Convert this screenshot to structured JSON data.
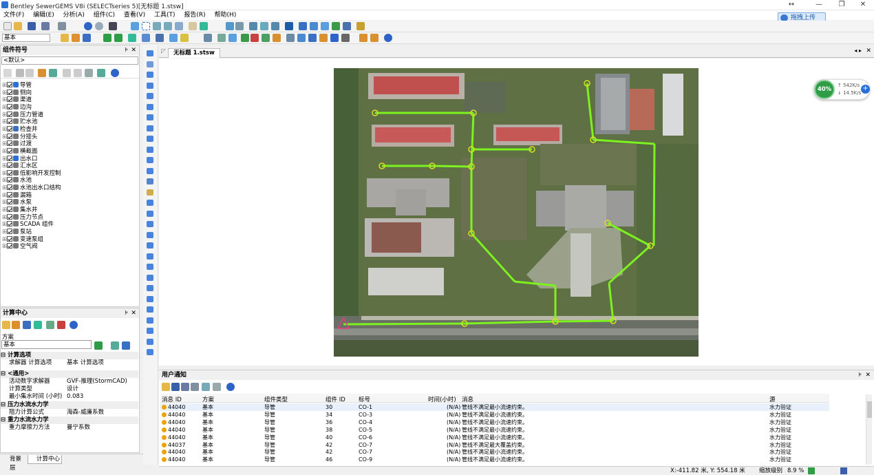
{
  "window": {
    "title": "Bentley SewerGEMS V8i (SELECTseries 5)[无标题 1.stsw]",
    "controls": [
      "↔",
      "—",
      "❐",
      "✕"
    ]
  },
  "cloud_button": "拖拽上传",
  "menu": [
    "文件(F)",
    "编辑(E)",
    "分析(A)",
    "组件(C)",
    "查看(V)",
    "工具(T)",
    "报告(R)",
    "帮助(H)"
  ],
  "toolbar": {
    "scenario_select": "基本"
  },
  "element_symbology": {
    "title": "组件符号",
    "dropdown": "<默认>",
    "items": [
      "导管",
      "侧向",
      "渠道",
      "边沟",
      "压力管道",
      "贮水池",
      "检查井",
      "分接头",
      "过渡",
      "横截面",
      "出水口",
      "汇水区",
      "低影响开发控制",
      "水池",
      "水池出水口结构",
      "漏箱",
      "水泵",
      "集水井",
      "压力节点",
      "SCADA 组件",
      "泵站",
      "变速泵组",
      "空气阀"
    ]
  },
  "calc_center": {
    "title": "计算中心",
    "scenario_label": "方案",
    "scenario_value": "基本",
    "sections": {
      "calc_options": "计算选项",
      "general": "<通用>",
      "pressure_hydraulics": "压力水流水力学",
      "gravity_hydraulics": "重力水流水力学"
    },
    "props": {
      "solver_k": "求解器 计算选项",
      "solver_v": "基本 计算选项",
      "active_solver_k": "活动数字求解器",
      "active_solver_v": "GVF-推理(StormCAD)",
      "calc_type_k": "计算类型",
      "calc_type_v": "设计",
      "min_time_k": "最小集水时间 (小时)",
      "min_time_v": "0.083",
      "friction_formula_k": "阻力计算公式",
      "friction_formula_v": "海森-威廉系数",
      "friction_method_k": "重力摩擦力方法",
      "friction_method_v": "曼宁系数"
    }
  },
  "bottom_tabs": {
    "background": "背景层",
    "calc": "计算中心"
  },
  "document_tab": "无标题 1.stsw",
  "network_speed": {
    "percent": "40%",
    "up": "542K/s",
    "down": "14.5K/s"
  },
  "notifications": {
    "title": "用户通知",
    "columns": [
      "消息 ID",
      "方案",
      "组件类型",
      "组件 ID",
      "标号",
      "时间(小时)",
      "消息",
      "源"
    ],
    "rows": [
      [
        "44040",
        "基本",
        "导管",
        "30",
        "CO-1",
        "(N/A)",
        "管线不满足最小流速约束。",
        "水力验证"
      ],
      [
        "44040",
        "基本",
        "导管",
        "34",
        "CO-3",
        "(N/A)",
        "管线不满足最小流速约束。",
        "水力验证"
      ],
      [
        "44040",
        "基本",
        "导管",
        "36",
        "CO-4",
        "(N/A)",
        "管线不满足最小流速约束。",
        "水力验证"
      ],
      [
        "44040",
        "基本",
        "导管",
        "38",
        "CO-5",
        "(N/A)",
        "管线不满足最小流速约束。",
        "水力验证"
      ],
      [
        "44040",
        "基本",
        "导管",
        "40",
        "CO-6",
        "(N/A)",
        "管线不满足最小流速约束。",
        "水力验证"
      ],
      [
        "44037",
        "基本",
        "导管",
        "42",
        "CO-7",
        "(N/A)",
        "管线不满足最大覆盖约束。",
        "水力验证"
      ],
      [
        "44040",
        "基本",
        "导管",
        "42",
        "CO-7",
        "(N/A)",
        "管线不满足最小流速约束。",
        "水力验证"
      ],
      [
        "44040",
        "基本",
        "导管",
        "46",
        "CO-9",
        "(N/A)",
        "管线不满足最小流速约束。",
        "水力验证"
      ]
    ]
  },
  "status": {
    "coords": "X:-411.82 米, Y: 554.18 米",
    "zoom_label": "缩放级别",
    "zoom_value": "8.9 %"
  },
  "colors": {
    "pipe": "#7cf21e",
    "outlet": "#e0407a",
    "accent": "#2a6fd6"
  }
}
